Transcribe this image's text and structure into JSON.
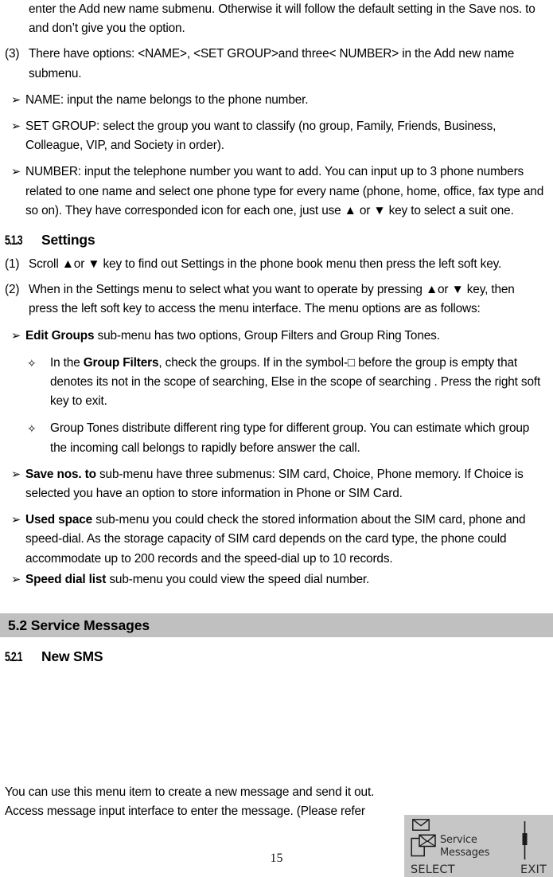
{
  "document": {
    "page_number": "15",
    "top_paragraph_continuation": "enter the Add new name submenu. Otherwise it will follow the default setting in the Save nos. to and don’t give you the option.",
    "item_3": {
      "number": "(3)",
      "text": "There have options: <NAME>, <SET GROUP>and three< NUMBER> in the Add new name submenu."
    },
    "field_bullets": [
      {
        "marker": "➢",
        "text": "NAME: input the name belongs to the phone number."
      },
      {
        "marker": "➢",
        "text": "SET GROUP: select the group you want to classify (no group, Family, Friends, Business, Colleague, VIP, and Society in order)."
      },
      {
        "marker": "➢",
        "text": "NUMBER: input the telephone number you want to add. You can input up to 3 phone numbers related to one name and select one phone type for every name (phone, home, office, fax type and so on). They have corresponded icon for each one, just use ▲ or ▼ key to select a suit one."
      }
    ],
    "section_513": {
      "number": "5.1.3",
      "title": "Settings"
    },
    "settings_steps": [
      {
        "number": "(1)",
        "text": "Scroll ▲or ▼ key to find out Settings in the phone book menu then press the left soft key."
      },
      {
        "number": "(2)",
        "text": "When in the Settings menu to select what you want to operate by pressing ▲or ▼ key, then press the left soft key to access the menu interface. The menu options are as follows:"
      }
    ],
    "menu_options": [
      {
        "marker": "➢",
        "bold_lead": "Edit Groups",
        "rest": " sub-menu has two options, Group Filters and Group Ring Tones.",
        "sub_items": [
          {
            "marker": "✧",
            "prefix": "In the ",
            "bold": "Group Filters",
            "rest": ", check the groups. If in the symbol-□ before the group is empty that denotes its not in the scope of searching, Else in the scope of searching . Press the right soft key to exit."
          },
          {
            "marker": "✧",
            "prefix": "",
            "bold": "",
            "rest": "Group Tones distribute different ring type for different group. You can estimate which group the incoming call belongs to rapidly before answer the call."
          }
        ]
      },
      {
        "marker": "➢",
        "bold_lead": "Save nos. to",
        "rest": " sub-menu have three submenus: SIM card, Choice, Phone memory. If Choice is selected you have an option to store information in Phone or SIM Card.",
        "sub_items": []
      },
      {
        "marker": "➢",
        "bold_lead": "Used space",
        "rest": " sub-menu you could check the stored information about the SIM card, phone and speed-dial. As the storage capacity of SIM card depends on the card type, the phone could accommodate up to 200 records and the speed-dial up to 10 records.",
        "sub_items": []
      },
      {
        "marker": "➢",
        "bold_lead": "Speed dial list",
        "rest": " sub-menu you could view the speed dial number.",
        "sub_items": []
      }
    ],
    "section_52": {
      "title": "5.2 Service Messages",
      "background_color": "#c0c0c0"
    },
    "section_521": {
      "number": "5.2.1",
      "title": "New SMS"
    },
    "closing_paragraph": "You can use this menu item to create a new message and send it out. Access message input interface to enter the message. (Please refer"
  },
  "phone_screen": {
    "background_color": "#c6c6c6",
    "menu_label_line1": "Service",
    "menu_label_line2": "Messages",
    "left_softkey": "SELECT",
    "right_softkey": "EXIT",
    "icons": {
      "status": "envelope-icon",
      "menu": "message-document-icon",
      "scrollbar": "scrollbar-icon"
    }
  }
}
